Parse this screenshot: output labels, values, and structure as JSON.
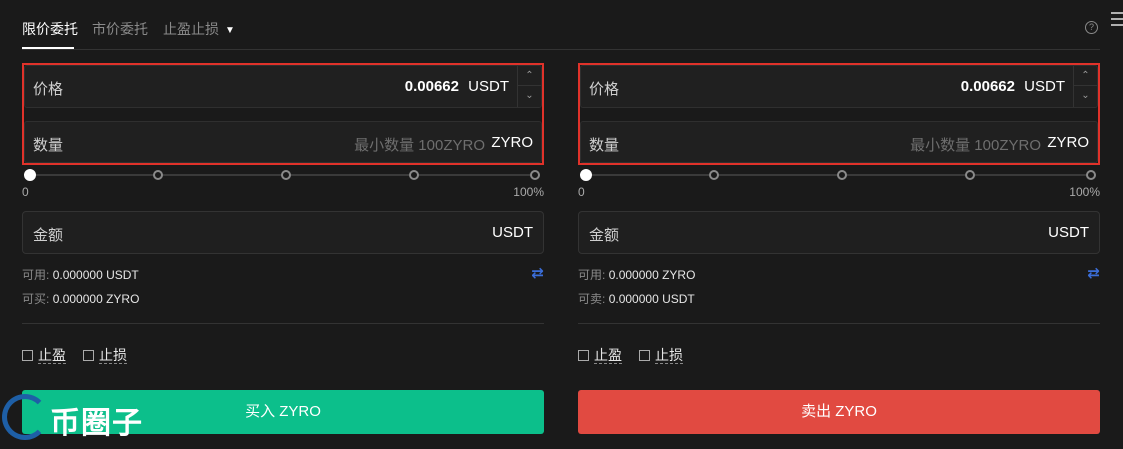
{
  "tabs": [
    {
      "label": "限价委托"
    },
    {
      "label": "市价委托"
    },
    {
      "label": "止盈止损"
    }
  ],
  "icons": {
    "help": "help-icon",
    "side": "side-panel-icon",
    "swap": "swap-icon",
    "chevron": "chevron-down-icon"
  },
  "buy": {
    "price_label": "价格",
    "price_value": "0.00662",
    "price_unit": "USDT",
    "qty_label": "数量",
    "qty_placeholder": "最小数量 100ZYRO",
    "qty_unit": "ZYRO",
    "slider_min": "0",
    "slider_max": "100%",
    "slider_value": 0,
    "amount_label": "金额",
    "amount_unit": "USDT",
    "avail_label": "可用:",
    "avail_value": "0.000000 USDT",
    "max_label": "可买:",
    "max_value": "0.000000 ZYRO",
    "tp_label": "止盈",
    "sl_label": "止损",
    "button": "买入 ZYRO"
  },
  "sell": {
    "price_label": "价格",
    "price_value": "0.00662",
    "price_unit": "USDT",
    "qty_label": "数量",
    "qty_placeholder": "最小数量 100ZYRO",
    "qty_unit": "ZYRO",
    "slider_min": "0",
    "slider_max": "100%",
    "slider_value": 0,
    "amount_label": "金额",
    "amount_unit": "USDT",
    "avail_label": "可用:",
    "avail_value": "0.000000 ZYRO",
    "max_label": "可卖:",
    "max_value": "0.000000 USDT",
    "tp_label": "止盈",
    "sl_label": "止损",
    "button": "卖出 ZYRO"
  },
  "watermark": "币圈子",
  "colors": {
    "buy": "#0cbf8b",
    "sell": "#e14a41",
    "highlight": "#e0322a",
    "swap": "#3b6ed9"
  }
}
